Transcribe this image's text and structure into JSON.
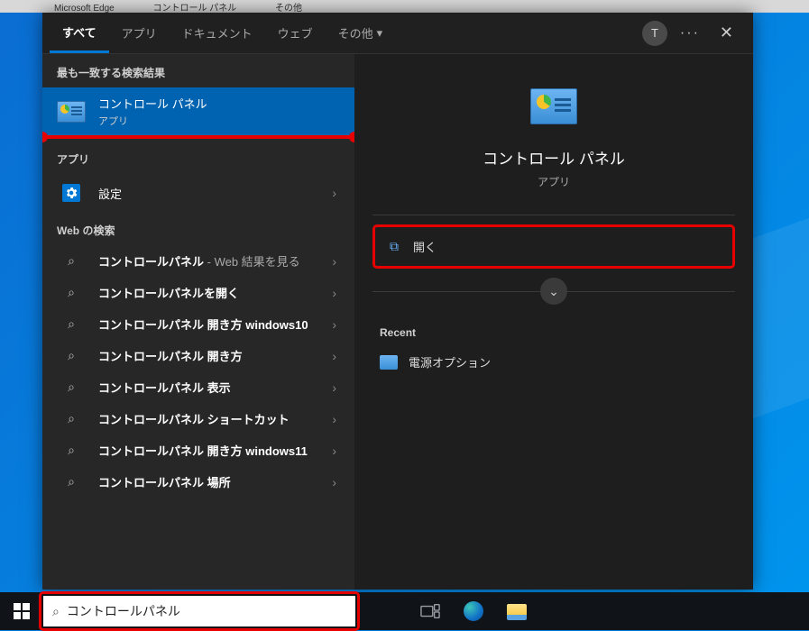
{
  "desktop_hints": [
    "Microsoft Edge",
    "コントロール パネル",
    "その他"
  ],
  "tabs": {
    "all": "すべて",
    "apps": "アプリ",
    "documents": "ドキュメント",
    "web": "ウェブ",
    "more": "その他"
  },
  "user_initial": "T",
  "sections": {
    "best_match": "最も一致する検索結果",
    "apps": "アプリ",
    "web_search": "Web の検索"
  },
  "best_result": {
    "title": "コントロール パネル",
    "subtitle": "アプリ"
  },
  "app_items": [
    {
      "label": "設定"
    }
  ],
  "web_items": [
    {
      "main": "コントロールパネル",
      "suffix": " - Web 結果を見る"
    },
    {
      "main": "コントロールパネルを開く",
      "suffix": ""
    },
    {
      "main": "コントロールパネル 開き方 windows10",
      "suffix": ""
    },
    {
      "main": "コントロールパネル 開き方",
      "suffix": ""
    },
    {
      "main": "コントロールパネル 表示",
      "suffix": ""
    },
    {
      "main": "コントロールパネル ショートカット",
      "suffix": ""
    },
    {
      "main": "コントロールパネル 開き方 windows11",
      "suffix": ""
    },
    {
      "main": "コントロールパネル 場所",
      "suffix": ""
    }
  ],
  "detail": {
    "title": "コントロール パネル",
    "subtitle": "アプリ",
    "open_label": "開く",
    "recent_header": "Recent",
    "recent_items": [
      {
        "label": "電源オプション"
      }
    ]
  },
  "search_input": "コントロールパネル"
}
